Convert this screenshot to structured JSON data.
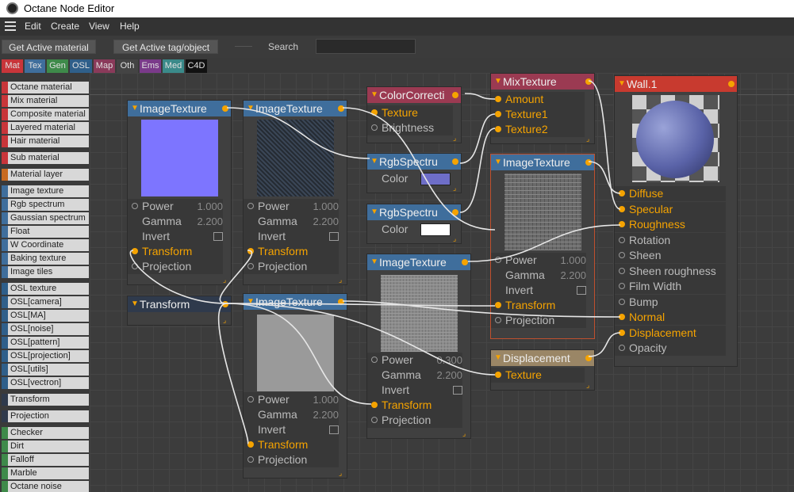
{
  "app": {
    "title": "Octane Node Editor"
  },
  "menu": {
    "items": [
      "Edit",
      "Create",
      "View",
      "Help"
    ]
  },
  "toolbar": {
    "get_material": "Get Active material",
    "get_tag": "Get Active tag/object",
    "search_label": "Search",
    "search_value": ""
  },
  "categories": [
    {
      "label": "Mat",
      "color": "#c8353a"
    },
    {
      "label": "Tex",
      "color": "#3f6e9c"
    },
    {
      "label": "Gen",
      "color": "#3e8a4a"
    },
    {
      "label": "OSL",
      "color": "#2f5f8a"
    },
    {
      "label": "Map",
      "color": "#8a3a5a"
    },
    {
      "label": "Oth",
      "color": "#444444"
    },
    {
      "label": "Ems",
      "color": "#7a3a8a"
    },
    {
      "label": "Med",
      "color": "#3a8a8a"
    },
    {
      "label": "C4D",
      "color": "#111111"
    }
  ],
  "sidebar": [
    {
      "label": "Octane material",
      "color": "#c8353a"
    },
    {
      "label": "Mix material",
      "color": "#c8353a"
    },
    {
      "label": "Composite material",
      "color": "#c8353a"
    },
    {
      "label": "Layered material",
      "color": "#c8353a"
    },
    {
      "label": "Hair material",
      "color": "#c8353a"
    },
    {
      "label": "Sub material",
      "color": "#c8353a"
    },
    {
      "label": "Material layer",
      "color": "#c86a20"
    },
    {
      "label": "Image texture",
      "color": "#3f6e9c"
    },
    {
      "label": "Rgb spectrum",
      "color": "#3f6e9c"
    },
    {
      "label": "Gaussian spectrum",
      "color": "#3f6e9c"
    },
    {
      "label": "Float",
      "color": "#3f6e9c"
    },
    {
      "label": "W Coordinate",
      "color": "#3f6e9c"
    },
    {
      "label": "Baking texture",
      "color": "#3f6e9c"
    },
    {
      "label": "Image tiles",
      "color": "#3f6e9c"
    },
    {
      "label": "OSL texture",
      "color": "#2f5f8a"
    },
    {
      "label": "OSL[camera]",
      "color": "#2f5f8a"
    },
    {
      "label": "OSL[MA]",
      "color": "#2f5f8a"
    },
    {
      "label": "OSL[noise]",
      "color": "#2f5f8a"
    },
    {
      "label": "OSL[pattern]",
      "color": "#2f5f8a"
    },
    {
      "label": "OSL[projection]",
      "color": "#2f5f8a"
    },
    {
      "label": "OSL[utils]",
      "color": "#2f5f8a"
    },
    {
      "label": "OSL[vectron]",
      "color": "#2f5f8a"
    },
    {
      "label": "Transform",
      "color": "#2f3a4c"
    },
    {
      "label": "Projection",
      "color": "#2f3a4c"
    },
    {
      "label": "Checker",
      "color": "#3e8a4a"
    },
    {
      "label": "Dirt",
      "color": "#3e8a4a"
    },
    {
      "label": "Falloff",
      "color": "#3e8a4a"
    },
    {
      "label": "Marble",
      "color": "#3e8a4a"
    },
    {
      "label": "Octane noise",
      "color": "#3e8a4a"
    }
  ],
  "nodes": {
    "img1": {
      "title": "ImageTexture",
      "power_label": "Power",
      "power": "1.000",
      "gamma_label": "Gamma",
      "gamma": "2.200",
      "invert": "Invert",
      "transform": "Transform",
      "projection": "Projection"
    },
    "img2": {
      "title": "ImageTexture",
      "power_label": "Power",
      "power": "1.000",
      "gamma_label": "Gamma",
      "gamma": "2.200",
      "invert": "Invert",
      "transform": "Transform",
      "projection": "Projection"
    },
    "img3": {
      "title": "ImageTexture",
      "power_label": "Power",
      "power": "1.000",
      "gamma_label": "Gamma",
      "gamma": "2.200",
      "invert": "Invert",
      "transform": "Transform",
      "projection": "Projection"
    },
    "img4": {
      "title": "ImageTexture",
      "power_label": "Power",
      "power": "0.300",
      "gamma_label": "Gamma",
      "gamma": "2.200",
      "invert": "Invert",
      "transform": "Transform",
      "projection": "Projection"
    },
    "img5": {
      "title": "ImageTexture",
      "power_label": "Power",
      "power": "1.000",
      "gamma_label": "Gamma",
      "gamma": "2.200",
      "invert": "Invert",
      "transform": "Transform",
      "projection": "Projection"
    },
    "transform": {
      "title": "Transform"
    },
    "colorcorrect": {
      "title": "ColorCorrecti",
      "texture": "Texture",
      "brightness": "Brightness"
    },
    "rgb1": {
      "title": "RgbSpectru",
      "color_label": "Color",
      "swatch": "#6e6ec8"
    },
    "rgb2": {
      "title": "RgbSpectru",
      "color_label": "Color",
      "swatch": "#ffffff"
    },
    "mix": {
      "title": "MixTexture",
      "amount": "Amount",
      "texture1": "Texture1",
      "texture2": "Texture2"
    },
    "displacement": {
      "title": "Displacement",
      "texture": "Texture"
    },
    "material": {
      "title": "Wall.1",
      "pins": [
        "Diffuse",
        "Specular",
        "Roughness",
        "Rotation",
        "Sheen",
        "Sheen roughness",
        "Film Width",
        "Bump",
        "Normal",
        "Displacement",
        "Opacity"
      ]
    }
  }
}
